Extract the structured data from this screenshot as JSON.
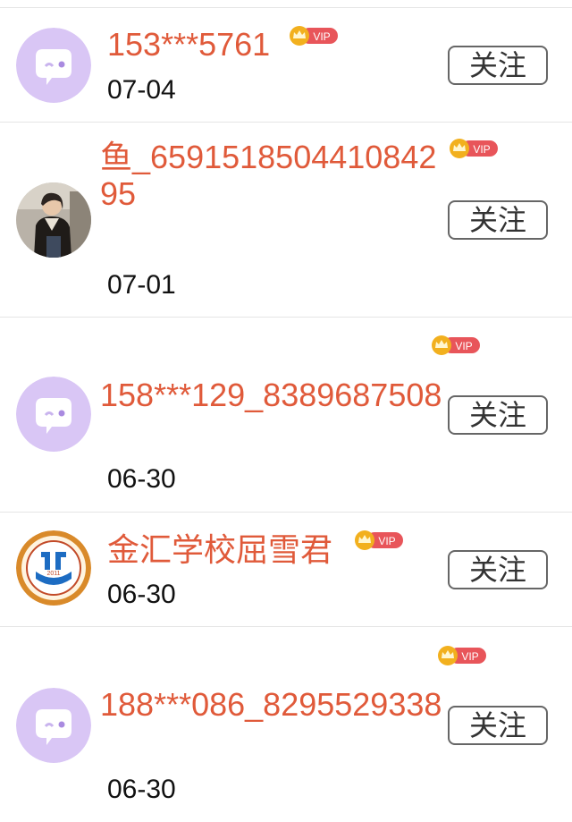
{
  "follow_label": "关注",
  "vip_label": "VIP",
  "colors": {
    "name": "#e05a3a",
    "vip_badge": "#e8555a",
    "crown": "#f2b01e",
    "default_avatar": "#d9c6f5"
  },
  "users": [
    {
      "name": "153***5761",
      "date": "07-04",
      "avatar": "default-chat-avatar"
    },
    {
      "name": "鱼_659151850441084295",
      "date": "07-01",
      "avatar": "photo-avatar"
    },
    {
      "name": "158***129_8389687508",
      "date": "06-30",
      "avatar": "default-chat-avatar"
    },
    {
      "name": "金汇学校屈雪君",
      "date": "06-30",
      "avatar": "school-logo-avatar"
    },
    {
      "name": "188***086_8295529338",
      "date": "06-30",
      "avatar": "default-chat-avatar"
    }
  ]
}
